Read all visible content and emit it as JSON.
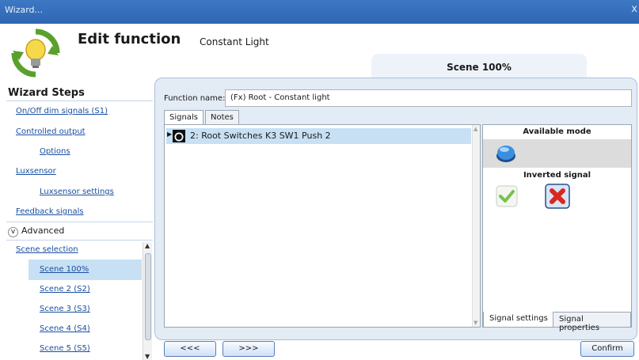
{
  "window": {
    "title": "Wizard...",
    "close": "x"
  },
  "header": {
    "title": "Edit function",
    "subtitle": "Constant Light",
    "scene_tab": "Scene 100%"
  },
  "sidebar": {
    "title": "Wizard Steps",
    "steps": [
      "On/Off dim signals (S1)",
      "Controlled output",
      "Options",
      "Luxsensor",
      "Luxsensor settings",
      "Feedback signals"
    ],
    "advanced": "Advanced",
    "scene_selection": "Scene selection",
    "scenes": [
      "Scene 100%",
      "Scene 2 (S2)",
      "Scene 3 (S3)",
      "Scene 4 (S4)",
      "Scene 5 (S5)"
    ]
  },
  "main": {
    "function_name_label": "Function name:",
    "function_name_value": "(Fx) Root - Constant light",
    "tabs": [
      "Signals",
      "Notes"
    ],
    "signals": [
      "2: Root Switches K3 SW1 Push 2"
    ]
  },
  "panel": {
    "available_mode": "Available mode",
    "inverted_signal": "Inverted signal",
    "tabs": [
      "Signal settings",
      "Signal properties"
    ]
  },
  "footer": {
    "prev": "<<<",
    "next": ">>>",
    "confirm": "Confirm"
  },
  "colors": {
    "accent": "#2f66b4",
    "selection": "#c7e0f4",
    "link": "#1a4fa0",
    "panel_bg": "#e3ebf5"
  }
}
